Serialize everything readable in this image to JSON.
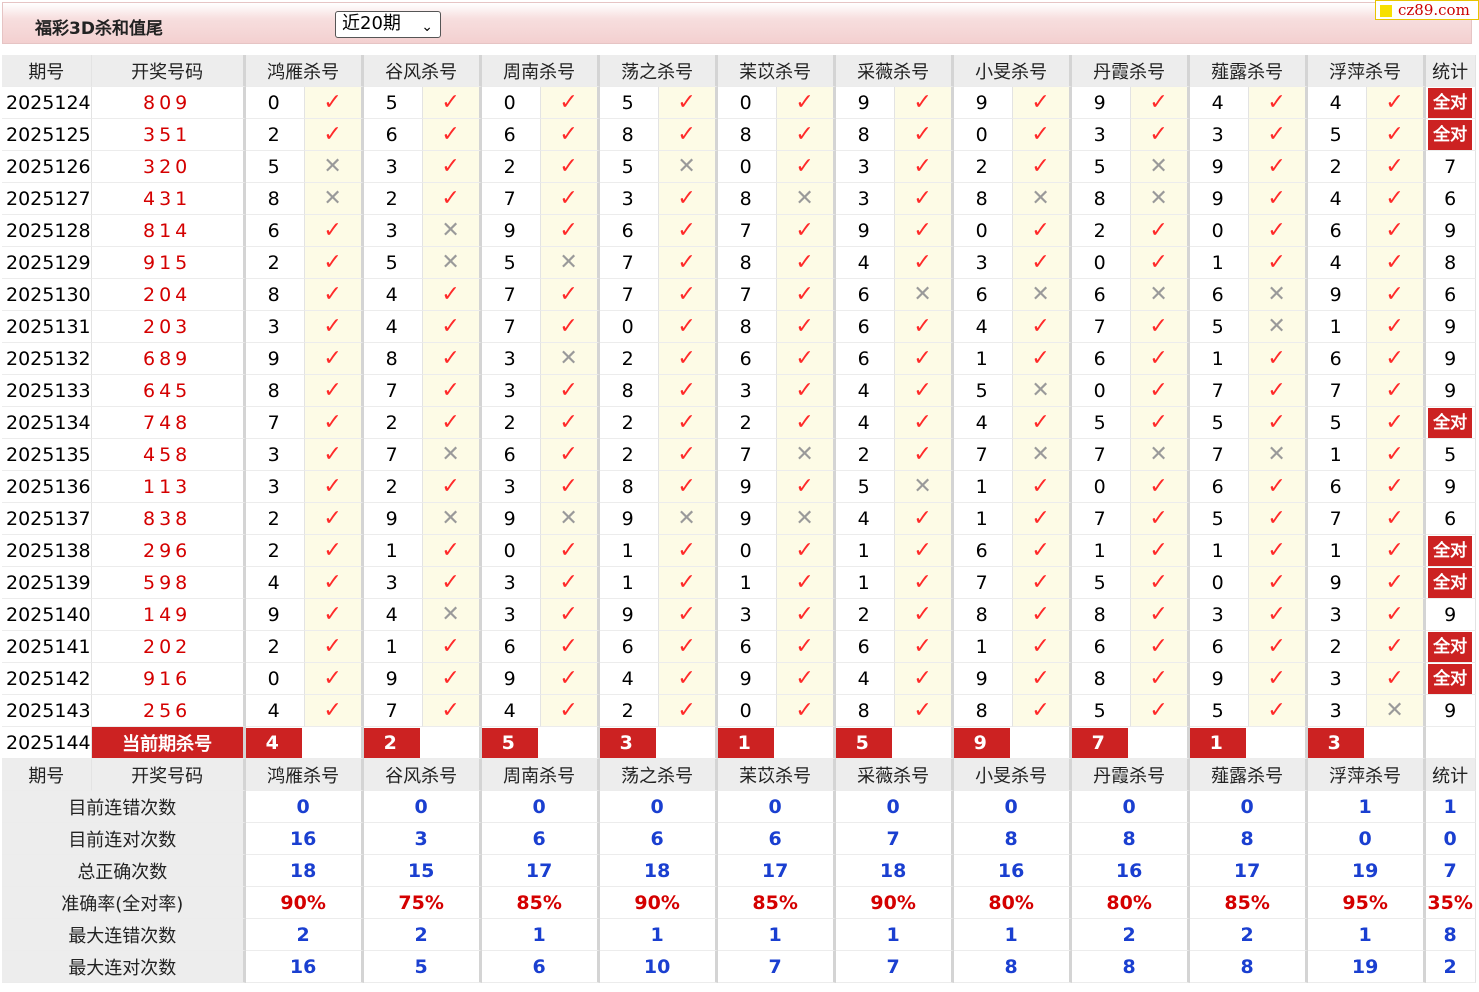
{
  "header": {
    "title": "福彩3D杀和值尾",
    "period_select": "近20期"
  },
  "logo": {
    "text": "cz89.com"
  },
  "columns": [
    "期号",
    "开奖号码",
    "鸿雁杀号",
    "谷风杀号",
    "周南杀号",
    "荡之杀号",
    "苿苡杀号",
    "采薇杀号",
    "小旻杀号",
    "丹霞杀号",
    "薤露杀号",
    "浮萍杀号",
    "统计"
  ],
  "rows": [
    {
      "period": "2025124",
      "draw": "809",
      "kills": [
        [
          0,
          true
        ],
        [
          5,
          true
        ],
        [
          0,
          true
        ],
        [
          5,
          true
        ],
        [
          0,
          true
        ],
        [
          9,
          true
        ],
        [
          9,
          true
        ],
        [
          9,
          true
        ],
        [
          4,
          true
        ],
        [
          4,
          true
        ]
      ],
      "stat": "全对"
    },
    {
      "period": "2025125",
      "draw": "351",
      "kills": [
        [
          2,
          true
        ],
        [
          6,
          true
        ],
        [
          6,
          true
        ],
        [
          8,
          true
        ],
        [
          8,
          true
        ],
        [
          8,
          true
        ],
        [
          0,
          true
        ],
        [
          3,
          true
        ],
        [
          3,
          true
        ],
        [
          5,
          true
        ]
      ],
      "stat": "全对"
    },
    {
      "period": "2025126",
      "draw": "320",
      "kills": [
        [
          5,
          false
        ],
        [
          3,
          true
        ],
        [
          2,
          true
        ],
        [
          5,
          false
        ],
        [
          0,
          true
        ],
        [
          3,
          true
        ],
        [
          2,
          true
        ],
        [
          5,
          false
        ],
        [
          9,
          true
        ],
        [
          2,
          true
        ]
      ],
      "stat": "7"
    },
    {
      "period": "2025127",
      "draw": "431",
      "kills": [
        [
          8,
          false
        ],
        [
          2,
          true
        ],
        [
          7,
          true
        ],
        [
          3,
          true
        ],
        [
          8,
          false
        ],
        [
          3,
          true
        ],
        [
          8,
          false
        ],
        [
          8,
          false
        ],
        [
          9,
          true
        ],
        [
          4,
          true
        ]
      ],
      "stat": "6"
    },
    {
      "period": "2025128",
      "draw": "814",
      "kills": [
        [
          6,
          true
        ],
        [
          3,
          false
        ],
        [
          9,
          true
        ],
        [
          6,
          true
        ],
        [
          7,
          true
        ],
        [
          9,
          true
        ],
        [
          0,
          true
        ],
        [
          2,
          true
        ],
        [
          0,
          true
        ],
        [
          6,
          true
        ]
      ],
      "stat": "9"
    },
    {
      "period": "2025129",
      "draw": "915",
      "kills": [
        [
          2,
          true
        ],
        [
          5,
          false
        ],
        [
          5,
          false
        ],
        [
          7,
          true
        ],
        [
          8,
          true
        ],
        [
          4,
          true
        ],
        [
          3,
          true
        ],
        [
          0,
          true
        ],
        [
          1,
          true
        ],
        [
          4,
          true
        ]
      ],
      "stat": "8"
    },
    {
      "period": "2025130",
      "draw": "204",
      "kills": [
        [
          8,
          true
        ],
        [
          4,
          true
        ],
        [
          7,
          true
        ],
        [
          7,
          true
        ],
        [
          7,
          true
        ],
        [
          6,
          false
        ],
        [
          6,
          false
        ],
        [
          6,
          false
        ],
        [
          6,
          false
        ],
        [
          9,
          true
        ]
      ],
      "stat": "6"
    },
    {
      "period": "2025131",
      "draw": "203",
      "kills": [
        [
          3,
          true
        ],
        [
          4,
          true
        ],
        [
          7,
          true
        ],
        [
          0,
          true
        ],
        [
          8,
          true
        ],
        [
          6,
          true
        ],
        [
          4,
          true
        ],
        [
          7,
          true
        ],
        [
          5,
          false
        ],
        [
          1,
          true
        ]
      ],
      "stat": "9"
    },
    {
      "period": "2025132",
      "draw": "689",
      "kills": [
        [
          9,
          true
        ],
        [
          8,
          true
        ],
        [
          3,
          false
        ],
        [
          2,
          true
        ],
        [
          6,
          true
        ],
        [
          6,
          true
        ],
        [
          1,
          true
        ],
        [
          6,
          true
        ],
        [
          1,
          true
        ],
        [
          6,
          true
        ]
      ],
      "stat": "9"
    },
    {
      "period": "2025133",
      "draw": "645",
      "kills": [
        [
          8,
          true
        ],
        [
          7,
          true
        ],
        [
          3,
          true
        ],
        [
          8,
          true
        ],
        [
          3,
          true
        ],
        [
          4,
          true
        ],
        [
          5,
          false
        ],
        [
          0,
          true
        ],
        [
          7,
          true
        ],
        [
          7,
          true
        ]
      ],
      "stat": "9"
    },
    {
      "period": "2025134",
      "draw": "748",
      "kills": [
        [
          7,
          true
        ],
        [
          2,
          true
        ],
        [
          2,
          true
        ],
        [
          2,
          true
        ],
        [
          2,
          true
        ],
        [
          4,
          true
        ],
        [
          4,
          true
        ],
        [
          5,
          true
        ],
        [
          5,
          true
        ],
        [
          5,
          true
        ]
      ],
      "stat": "全对"
    },
    {
      "period": "2025135",
      "draw": "458",
      "kills": [
        [
          3,
          true
        ],
        [
          7,
          false
        ],
        [
          6,
          true
        ],
        [
          2,
          true
        ],
        [
          7,
          false
        ],
        [
          2,
          true
        ],
        [
          7,
          false
        ],
        [
          7,
          false
        ],
        [
          7,
          false
        ],
        [
          1,
          true
        ]
      ],
      "stat": "5"
    },
    {
      "period": "2025136",
      "draw": "113",
      "kills": [
        [
          3,
          true
        ],
        [
          2,
          true
        ],
        [
          3,
          true
        ],
        [
          8,
          true
        ],
        [
          9,
          true
        ],
        [
          5,
          false
        ],
        [
          1,
          true
        ],
        [
          0,
          true
        ],
        [
          6,
          true
        ],
        [
          6,
          true
        ]
      ],
      "stat": "9"
    },
    {
      "period": "2025137",
      "draw": "838",
      "kills": [
        [
          2,
          true
        ],
        [
          9,
          false
        ],
        [
          9,
          false
        ],
        [
          9,
          false
        ],
        [
          9,
          false
        ],
        [
          4,
          true
        ],
        [
          1,
          true
        ],
        [
          7,
          true
        ],
        [
          5,
          true
        ],
        [
          7,
          true
        ]
      ],
      "stat": "6"
    },
    {
      "period": "2025138",
      "draw": "296",
      "kills": [
        [
          2,
          true
        ],
        [
          1,
          true
        ],
        [
          0,
          true
        ],
        [
          1,
          true
        ],
        [
          0,
          true
        ],
        [
          1,
          true
        ],
        [
          6,
          true
        ],
        [
          1,
          true
        ],
        [
          1,
          true
        ],
        [
          1,
          true
        ]
      ],
      "stat": "全对"
    },
    {
      "period": "2025139",
      "draw": "598",
      "kills": [
        [
          4,
          true
        ],
        [
          3,
          true
        ],
        [
          3,
          true
        ],
        [
          1,
          true
        ],
        [
          1,
          true
        ],
        [
          1,
          true
        ],
        [
          7,
          true
        ],
        [
          5,
          true
        ],
        [
          0,
          true
        ],
        [
          9,
          true
        ]
      ],
      "stat": "全对"
    },
    {
      "period": "2025140",
      "draw": "149",
      "kills": [
        [
          9,
          true
        ],
        [
          4,
          false
        ],
        [
          3,
          true
        ],
        [
          9,
          true
        ],
        [
          3,
          true
        ],
        [
          2,
          true
        ],
        [
          8,
          true
        ],
        [
          8,
          true
        ],
        [
          3,
          true
        ],
        [
          3,
          true
        ]
      ],
      "stat": "9"
    },
    {
      "period": "2025141",
      "draw": "202",
      "kills": [
        [
          2,
          true
        ],
        [
          1,
          true
        ],
        [
          6,
          true
        ],
        [
          6,
          true
        ],
        [
          6,
          true
        ],
        [
          6,
          true
        ],
        [
          1,
          true
        ],
        [
          6,
          true
        ],
        [
          6,
          true
        ],
        [
          2,
          true
        ]
      ],
      "stat": "全对"
    },
    {
      "period": "2025142",
      "draw": "916",
      "kills": [
        [
          0,
          true
        ],
        [
          9,
          true
        ],
        [
          9,
          true
        ],
        [
          4,
          true
        ],
        [
          9,
          true
        ],
        [
          4,
          true
        ],
        [
          9,
          true
        ],
        [
          8,
          true
        ],
        [
          9,
          true
        ],
        [
          3,
          true
        ]
      ],
      "stat": "全对"
    },
    {
      "period": "2025143",
      "draw": "256",
      "kills": [
        [
          4,
          true
        ],
        [
          7,
          true
        ],
        [
          4,
          true
        ],
        [
          2,
          true
        ],
        [
          0,
          true
        ],
        [
          8,
          true
        ],
        [
          8,
          true
        ],
        [
          5,
          true
        ],
        [
          5,
          true
        ],
        [
          3,
          false
        ]
      ],
      "stat": "9"
    }
  ],
  "current": {
    "period": "2025144",
    "label": "当前期杀号",
    "kills": [
      4,
      2,
      5,
      3,
      1,
      5,
      9,
      7,
      1,
      3
    ]
  },
  "stats": [
    {
      "label": "目前连错次数",
      "values": [
        "0",
        "0",
        "0",
        "0",
        "0",
        "0",
        "0",
        "0",
        "0",
        "1",
        "1"
      ]
    },
    {
      "label": "目前连对次数",
      "values": [
        "16",
        "3",
        "6",
        "6",
        "6",
        "7",
        "8",
        "8",
        "8",
        "0",
        "0"
      ]
    },
    {
      "label": "总正确次数",
      "values": [
        "18",
        "15",
        "17",
        "18",
        "17",
        "18",
        "16",
        "16",
        "17",
        "19",
        "7"
      ]
    },
    {
      "label": "准确率(全对率)",
      "values": [
        "90%",
        "75%",
        "85%",
        "90%",
        "85%",
        "90%",
        "80%",
        "80%",
        "85%",
        "95%",
        "35%"
      ],
      "rate": true
    },
    {
      "label": "最大连错次数",
      "values": [
        "2",
        "2",
        "1",
        "1",
        "1",
        "1",
        "1",
        "2",
        "2",
        "1",
        "8"
      ]
    },
    {
      "label": "最大连对次数",
      "values": [
        "16",
        "5",
        "6",
        "10",
        "7",
        "7",
        "8",
        "8",
        "8",
        "19",
        "2"
      ]
    }
  ],
  "symbols": {
    "ok": "✓",
    "no": "✕"
  },
  "colors": {
    "accent_red": "#cc2222",
    "stat_blue": "#1a3fd0",
    "draw_red": "#d40000",
    "mark_bg": "#fdfbe6"
  }
}
